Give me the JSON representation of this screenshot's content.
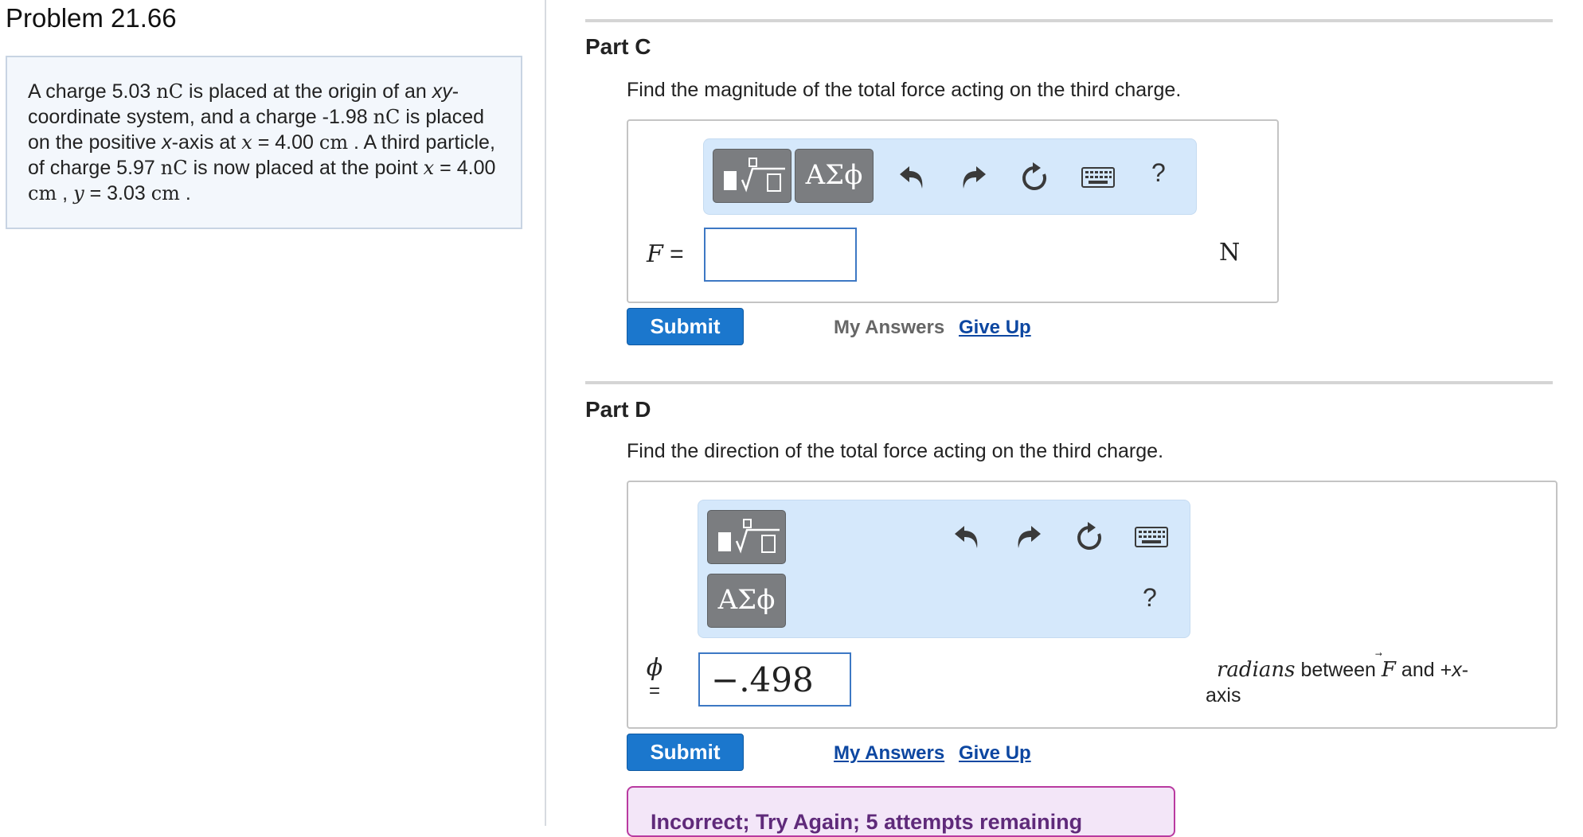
{
  "problem": {
    "title": "Problem 21.66",
    "text": {
      "p1": "A charge 5.03",
      "u1": "nC",
      "p2": "is placed at the origin of an",
      "xy": "xy",
      "p3": "-coordinate system, and a charge -1.98",
      "u2": "nC",
      "p4": "is placed on the positive",
      "xaxis": "x",
      "p5": "-axis at",
      "xvar": "x",
      "p6": "= 4.00",
      "u3": "cm",
      "p7": ". A third particle, of charge 5.97",
      "u4": "nC",
      "p8": "is now placed at the point",
      "xvar2": "x",
      "p9": "= 4.00",
      "u5": "cm",
      "p10": ",",
      "yvar": "y",
      "p11": "= 3.03",
      "u6": "cm",
      "p12": "."
    }
  },
  "partC": {
    "title": "Part C",
    "prompt": "Find the magnitude of the total force acting on the third charge.",
    "toolbar": {
      "greek": "ΑΣϕ",
      "help": "?"
    },
    "variable": "F",
    "equals": "=",
    "input_value": "",
    "unit": "N",
    "submit": "Submit",
    "my_answers": "My Answers",
    "give_up": "Give Up"
  },
  "partD": {
    "title": "Part D",
    "prompt": "Find the direction of the total force acting on the third charge.",
    "toolbar": {
      "greek": "ΑΣϕ",
      "help": "?"
    },
    "variable": "ϕ",
    "equals": "=",
    "input_value": "−.498",
    "unit_word": "radians",
    "unit_mid": "between",
    "unit_vec": "F",
    "unit_end1": "and +",
    "unit_x": "x",
    "unit_end2": "-",
    "unit_end3": "axis",
    "submit": "Submit",
    "my_answers": "My Answers",
    "give_up": "Give Up",
    "feedback": "Incorrect; Try Again; 5 attempts remaining"
  },
  "colors": {
    "accent": "#1b77cd",
    "toolbar": "#d5e8fb",
    "feedback_bg": "#f3e6f8",
    "feedback_text": "#5f2a7a"
  },
  "icons": [
    "templates-icon",
    "greek-icon",
    "undo-icon",
    "redo-icon",
    "reset-icon",
    "keyboard-icon",
    "help-icon"
  ]
}
